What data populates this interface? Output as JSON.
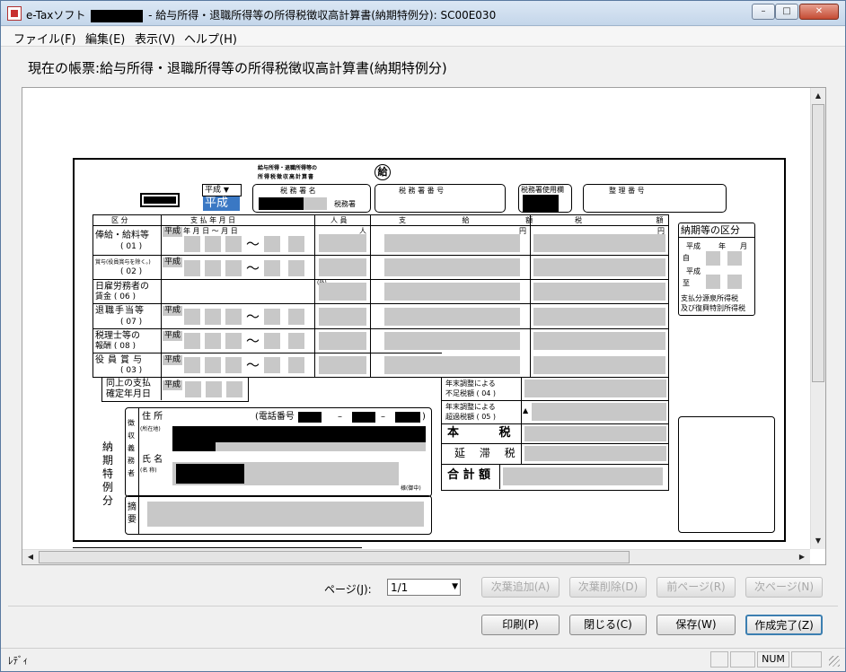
{
  "window": {
    "app_name": "e-Taxソフト",
    "title_suffix": "- 給与所得・退職所得等の所得税徴収高計算書(納期特例分): SC00E030",
    "min": "–",
    "max": "□",
    "close": "✕"
  },
  "menu": [
    {
      "label": "ファイル(F)"
    },
    {
      "label": "編集(E)"
    },
    {
      "label": "表示(V)"
    },
    {
      "label": "ヘルプ(H)"
    }
  ],
  "current_form": "現在の帳票:給与所得・退職所得等の所得税徴収高計算書(納期特例分)",
  "form": {
    "header_title_1": "給与所得・退職所得等の",
    "header_title_2": "所得税徴収高計算書",
    "kyu": "給",
    "era_select": "平成",
    "era_select_arrow": "▼",
    "era_highlight": "平成",
    "tax_office_name_label": "税 務 署 名",
    "tax_office_suffix": "税務署",
    "tax_office_no_label": "税 務 署 番 号",
    "tax_office_use_label": "税務署使用欄",
    "seiri_label": "整 理 番 号",
    "col_kubun": "区 分",
    "col_shikyu": "支 払 年 月 日",
    "col_ninzu": "人 員",
    "col_shikyugaku": "支 給 額",
    "col_zeigaku": "税 額",
    "unit_nin": "人",
    "unit_en1": "円",
    "unit_en2": "円",
    "rows": [
      {
        "label1": "俸給・給料等",
        "label2": "( 01 )",
        "heisei": "平成"
      },
      {
        "label1": "賞与(役員賞与を除く。)",
        "label2": "( 02 )",
        "heisei": "平成"
      },
      {
        "label1": "日雇労務者の",
        "label2": "賃金 ( 06 )",
        "heisei": ""
      },
      {
        "label1": "退職手当等",
        "label2": "( 07 )",
        "heisei": "平成"
      },
      {
        "label1": "税理士等の",
        "label2": "報酬 ( 08 )",
        "heisei": "平成"
      },
      {
        "label1": "役員賞与",
        "label2": "( 03 )",
        "heisei": "平成"
      }
    ],
    "date_head": "年 月 日 〜 月 日",
    "tilde": "〜",
    "kaku": "(外)",
    "dojo_label1": "同上の支払",
    "dojo_label2": "確定年月日",
    "dojo_heisei": "平成",
    "nenmatsu1_a": "年末調整による",
    "nenmatsu1_b": "不足税額 ( 04 )",
    "nenmatsu2_a": "年末調整による",
    "nenmatsu2_b": "超過税額 ( 05 )",
    "triangle": "▲",
    "honzei": "本 税",
    "entai": "延 滞 税",
    "gokei": "合 計 額",
    "nouki_kubun": "納期等の区分",
    "nouki_heisei1": "平成",
    "nouki_nen": "年",
    "nouki_tsuki": "月",
    "nouki_ji": "自",
    "nouki_heisei2": "平成",
    "nouki_itaru": "至",
    "nouki_note1": "支払分源泉所得税",
    "nouki_note2": "及び復興特別所得税",
    "side_label": "納期特例分",
    "chosha": "徴収義務者",
    "jusho": "住 所",
    "shozaichi": "(所在地)",
    "denwa": "(電話番号",
    "dash": "–",
    "close_paren": ")",
    "shimei": "氏 名",
    "meisho": "(名 称)",
    "sama": "様(御中)",
    "tekiyo": "摘要"
  },
  "pager": {
    "label": "ページ(J):",
    "value": "1/1",
    "arrow": "▼"
  },
  "buttons": {
    "add_page": "次葉追加(A)",
    "del_page": "次葉削除(D)",
    "prev_page": "前ページ(R)",
    "next_page": "次ページ(N)",
    "print": "印刷(P)",
    "close": "閉じる(C)",
    "save": "保存(W)",
    "finish": "作成完了(Z)"
  },
  "status": {
    "text": "ﾚﾃﾞｨ",
    "num": "NUM"
  },
  "colors": {
    "field_gray": "#c8c8c8",
    "highlight_blue": "#3a78c4",
    "default_button_border": "#3c7fb1"
  }
}
